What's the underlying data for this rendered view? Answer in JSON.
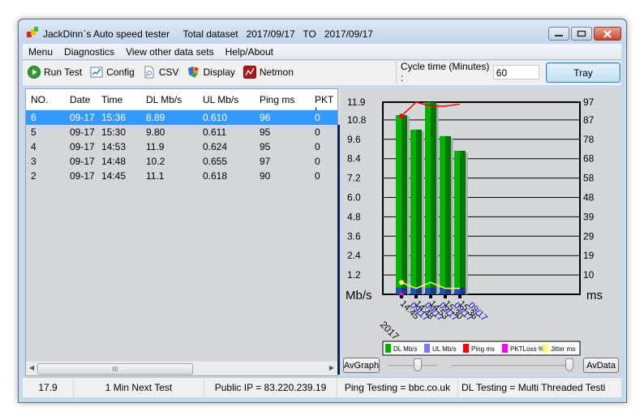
{
  "window": {
    "title": "JackDinn`s Auto speed tester     Total dataset   2017/09/17   TO   2017/09/17",
    "controls": [
      "minimize",
      "maximize",
      "close"
    ]
  },
  "menubar": {
    "items": [
      {
        "label": "Menu"
      },
      {
        "label": "Diagnostics"
      },
      {
        "label": "View other data sets"
      },
      {
        "label": "Help/About"
      }
    ]
  },
  "toolbar": {
    "items": [
      {
        "label": "Run Test",
        "icon": "play-icon"
      },
      {
        "label": "Config",
        "icon": "config-chart-icon"
      },
      {
        "label": "CSV",
        "icon": "document-search-icon"
      },
      {
        "label": "Display",
        "icon": "display-palette-icon"
      },
      {
        "label": "Netmon",
        "icon": "netmon-icon"
      }
    ],
    "cycle_label": "Cycle time (Minutes) :",
    "cycle_value": "60",
    "tray_label": "Tray"
  },
  "table": {
    "columns": [
      "NO.",
      "Date",
      "Time",
      "DL Mb/s",
      "UL Mb/s",
      "Ping ms",
      "PKT L"
    ],
    "rows": [
      {
        "no": "6",
        "date": "09-17",
        "time": "15:36",
        "dl": "8.89",
        "ul": "0.610",
        "ping": "96",
        "pkt": "0",
        "selected": true
      },
      {
        "no": "5",
        "date": "09-17",
        "time": "15:30",
        "dl": "9.80",
        "ul": "0.611",
        "ping": "95",
        "pkt": "0",
        "selected": false
      },
      {
        "no": "4",
        "date": "09-17",
        "time": "14:53",
        "dl": "11.9",
        "ul": "0.624",
        "ping": "95",
        "pkt": "0",
        "selected": false
      },
      {
        "no": "3",
        "date": "09-17",
        "time": "14:48",
        "dl": "10.2",
        "ul": "0.655",
        "ping": "97",
        "pkt": "0",
        "selected": false
      },
      {
        "no": "2",
        "date": "09-17",
        "time": "14:45",
        "dl": "11.1",
        "ul": "0.618",
        "ping": "90",
        "pkt": "0",
        "selected": false
      }
    ],
    "hscroll_grip": "III"
  },
  "graph_controls": {
    "avgraph_label": "AvGraph",
    "avdata_label": "AvData",
    "slider1_value": 0.6,
    "slider2_value": 1.0
  },
  "chart_data": {
    "type": "bar",
    "categories": [
      "14:45",
      "14:48",
      "14:53",
      "15:30",
      "15:36"
    ],
    "category_dates": [
      "09/17",
      "09/17",
      "09/17",
      "09/17",
      "09/17"
    ],
    "year_label": "2017",
    "series": [
      {
        "name": "DL Mb/s",
        "axis": "left",
        "kind": "bar",
        "color": "#00b000",
        "values": [
          11.1,
          10.2,
          11.9,
          9.8,
          8.89
        ]
      },
      {
        "name": "UL Mb/s",
        "axis": "left",
        "kind": "bar",
        "color": "#1f4fb4",
        "values": [
          0.618,
          0.655,
          0.624,
          0.611,
          0.61
        ]
      },
      {
        "name": "Ping ms",
        "axis": "right",
        "kind": "line",
        "color": "#ff0000",
        "values": [
          90,
          97,
          95,
          95,
          96
        ]
      },
      {
        "name": "PKTLoss %",
        "axis": "right",
        "kind": "line",
        "color": "#ff00ff",
        "values": [
          0,
          0,
          0,
          0,
          0
        ]
      },
      {
        "name": "Jitter ms",
        "axis": "right",
        "kind": "line",
        "color": "#ffff66",
        "values": [
          6,
          3,
          6,
          3,
          3
        ]
      }
    ],
    "left_axis": {
      "label": "Mb/s",
      "ticks": [
        "1.2",
        "2.4",
        "3.6",
        "4.8",
        "6.0",
        "7.2",
        "8.4",
        "9.6",
        "10.8",
        "11.9"
      ],
      "range": [
        0,
        11.9
      ]
    },
    "right_axis": {
      "label": "ms",
      "ticks": [
        "10",
        "19",
        "29",
        "39",
        "48",
        "58",
        "68",
        "78",
        "87",
        "97"
      ],
      "range": [
        0,
        97
      ]
    },
    "grid": true,
    "legend": [
      {
        "label": "DL Mb/s",
        "color": "#00b000"
      },
      {
        "label": "UL Mb/s",
        "color": "#7777ff"
      },
      {
        "label": "Ping ms",
        "color": "#ff0000"
      },
      {
        "label": "PKTLoss %",
        "color": "#ff00ff"
      },
      {
        "label": "Jitter ms",
        "color": "#ffff80"
      }
    ],
    "legend_position": "bottom"
  },
  "statusbar": {
    "items": [
      "17.9",
      "1 Min Next Test",
      "Public IP = 83.220.239.19",
      "Ping Testing = bbc.co.uk",
      "DL Testing = Multi Threaded Testi"
    ]
  }
}
